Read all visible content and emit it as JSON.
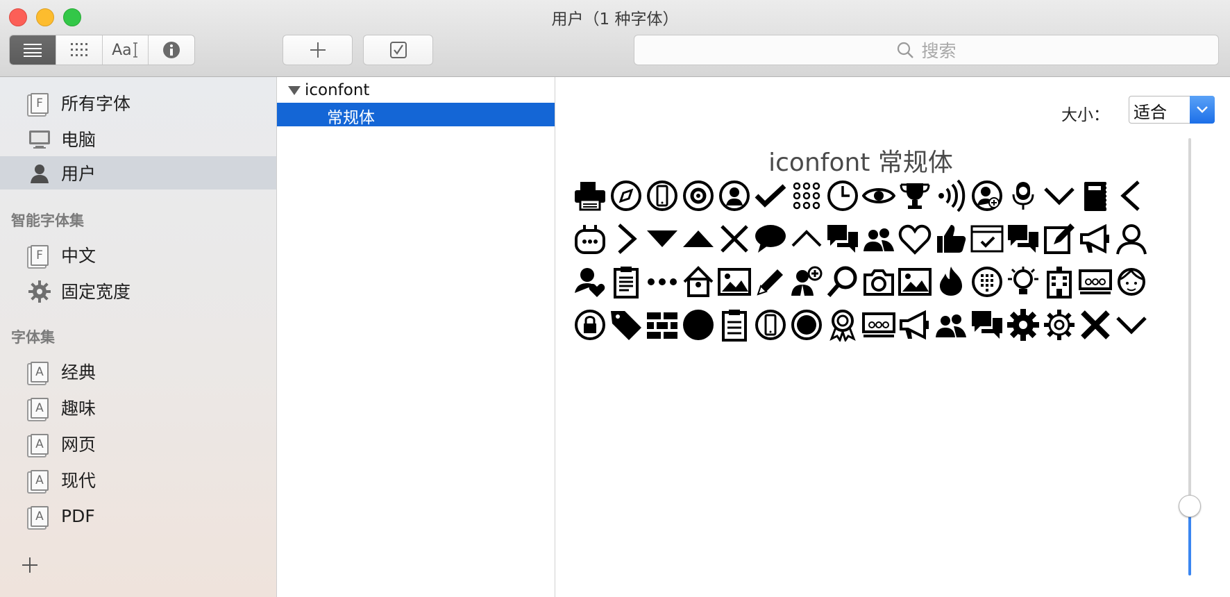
{
  "window": {
    "title": "用户（1 种字体）"
  },
  "toolbar": {
    "view_buttons": [
      {
        "icon": "list-view-icon",
        "active": true
      },
      {
        "icon": "grid-view-icon",
        "active": false
      },
      {
        "label": "Aa",
        "icon": "sample-view-icon",
        "active": false
      },
      {
        "icon": "info-icon",
        "active": false
      }
    ],
    "add_icon": "plus-icon",
    "validate_icon": "checkbox-icon",
    "search_placeholder": "搜索"
  },
  "sidebar": {
    "library_items": [
      {
        "label": "所有字体",
        "icon": "font-box-icon",
        "selected": false
      },
      {
        "label": "电脑",
        "icon": "computer-icon",
        "selected": false
      },
      {
        "label": "用户",
        "icon": "user-icon",
        "selected": true
      }
    ],
    "smart_header": "智能字体集",
    "smart_items": [
      {
        "label": "中文",
        "icon": "font-box-icon"
      },
      {
        "label": "固定宽度",
        "icon": "gear-icon"
      }
    ],
    "collections_header": "字体集",
    "collection_items": [
      {
        "label": "经典",
        "icon": "collection-box-icon"
      },
      {
        "label": "趣味",
        "icon": "collection-box-icon"
      },
      {
        "label": "网页",
        "icon": "collection-box-icon"
      },
      {
        "label": "现代",
        "icon": "collection-box-icon"
      },
      {
        "label": "PDF",
        "icon": "collection-box-icon"
      }
    ],
    "add_icon": "plus-icon"
  },
  "fontlist": {
    "family": "iconfont",
    "style": "常规体",
    "expanded": true,
    "selected_style": true
  },
  "preview": {
    "size_label": "大小：",
    "size_value": "适合",
    "title": "iconfont 常规体",
    "size_slider_level": 0.16,
    "glyph_rows": [
      [
        "printer-icon",
        "compass-circle-icon",
        "phone-circle-icon",
        "gear-circle-icon",
        "woman-avatar-icon",
        "check-icon",
        "dial-grid-icon",
        "clock-icon",
        "eye-icon",
        "trophy-icon",
        "signal-waves-icon",
        "add-user-circle-icon",
        "mic-icon",
        "chevron-down-icon",
        "notebook-icon",
        "chevron-left-icon"
      ],
      [
        "robot-icon",
        "chevron-right-icon",
        "triangle-down-icon",
        "triangle-up-icon",
        "close-icon",
        "speech-bubble-icon",
        "chevron-up-icon",
        "chat-bubbles-icon",
        "group-icon",
        "heart-icon",
        "thumbs-up-icon",
        "browser-check-icon",
        "chat-bubbles-icon",
        "edit-icon",
        "megaphone-icon",
        "person-icon"
      ],
      [
        "user-heart-icon",
        "clipboard-icon",
        "ellipsis-icon",
        "birdhouse-icon",
        "image-icon",
        "pencil-icon",
        "add-business-user-icon",
        "search-icon",
        "camera-icon",
        "image-icon",
        "flame-icon",
        "keypad-circle-icon",
        "lightbulb-icon",
        "building-icon",
        "presentation-icon",
        "child-face-icon"
      ],
      [
        "lock-circle-icon",
        "tag-icon",
        "wall-icon",
        "filled-circle-icon",
        "clipboard-list-icon",
        "phone-circle-icon",
        "ring-circle-icon",
        "award-icon",
        "presentation-icon",
        "megaphone-icon",
        "group-icon",
        "chat-bubbles-icon",
        "gear-filled-icon",
        "gear-outline-icon",
        "close-bold-icon",
        "chevron-down-icon"
      ]
    ]
  }
}
